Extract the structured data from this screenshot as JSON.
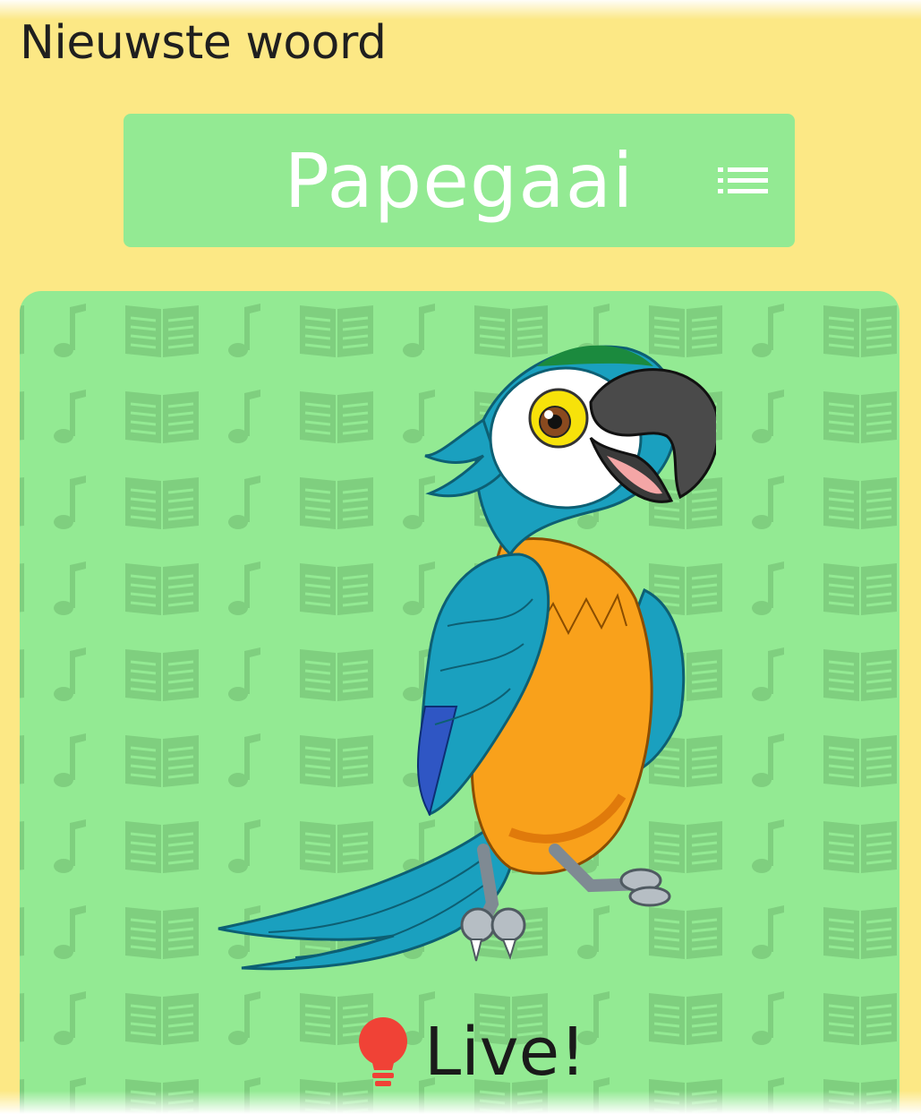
{
  "section": {
    "title": "Nieuwste woord"
  },
  "word": {
    "label": "Papegaai",
    "list_icon": "list-icon"
  },
  "card": {
    "image_icon": "parrot-illustration",
    "background_pattern_icons": [
      "music-note-icon",
      "open-book-icon"
    ],
    "status_icon": "lightbulb-icon",
    "status_label": "Live!"
  },
  "colors": {
    "background": "#fce885",
    "banner": "#93ea93",
    "card": "#93ea93",
    "banner_text": "#ffffff",
    "bulb": "#f04236"
  }
}
